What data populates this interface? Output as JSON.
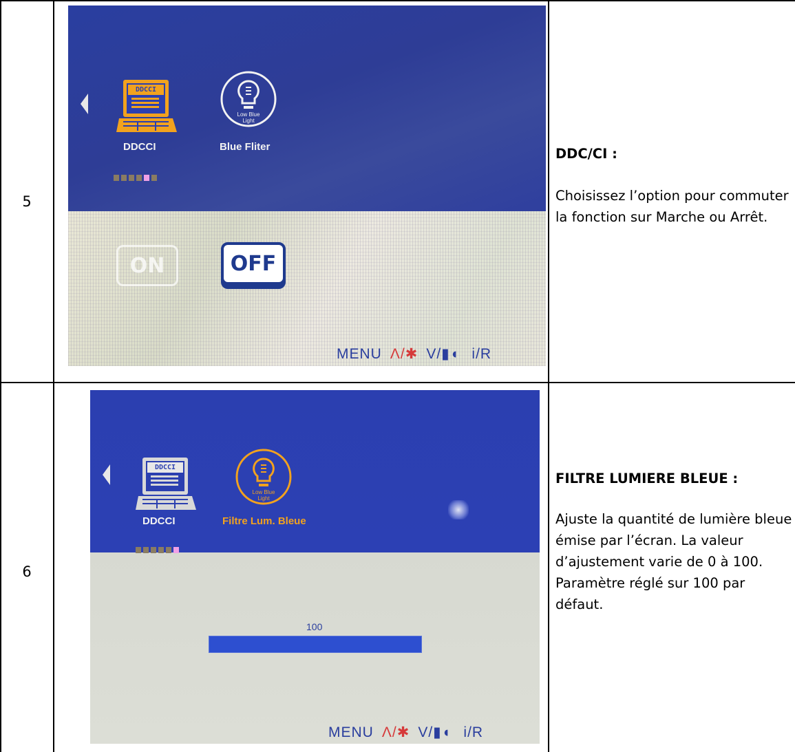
{
  "rows": [
    {
      "number": "5",
      "osd": {
        "icons": [
          {
            "name": "ddcci-icon",
            "label": "DDCCI",
            "badge": "DDCCI"
          },
          {
            "name": "low-blue-light-icon",
            "label": "Blue Fliter",
            "badge": "Low Blue Light"
          }
        ],
        "options": {
          "on": "ON",
          "off": "OFF"
        },
        "keys": {
          "menu": "MENU",
          "up": "Λ/✱",
          "down": "V/▮◖",
          "info": "i/R"
        }
      },
      "heading": "DDC/CI :",
      "body": "Choisissez l’option pour commuter la fonction sur Marche ou Arrêt."
    },
    {
      "number": "6",
      "osd": {
        "icons": [
          {
            "name": "ddcci-icon",
            "label": "DDCCI",
            "badge": "DDCCI"
          },
          {
            "name": "low-blue-light-icon",
            "label": "Filtre Lum. Bleue",
            "badge": "Low Blue Light"
          }
        ],
        "slider_value": "100",
        "slider_level": 100,
        "keys": {
          "menu": "MENU",
          "up": "Λ/✱",
          "down": "V/▮◖",
          "info": "i/R"
        }
      },
      "heading": "FILTRE LUMIERE BLEUE :",
      "body": "Ajuste la quantité de lumière bleue émise par   l’écran. La valeur d’ajustement varie de 0 à 100. Paramètre réglé sur 100 par défaut."
    }
  ],
  "colors": {
    "osd_blue": "#2b3fb0",
    "selected_orange": "#f2a21e",
    "highlight_pink": "#f0a0e6"
  }
}
